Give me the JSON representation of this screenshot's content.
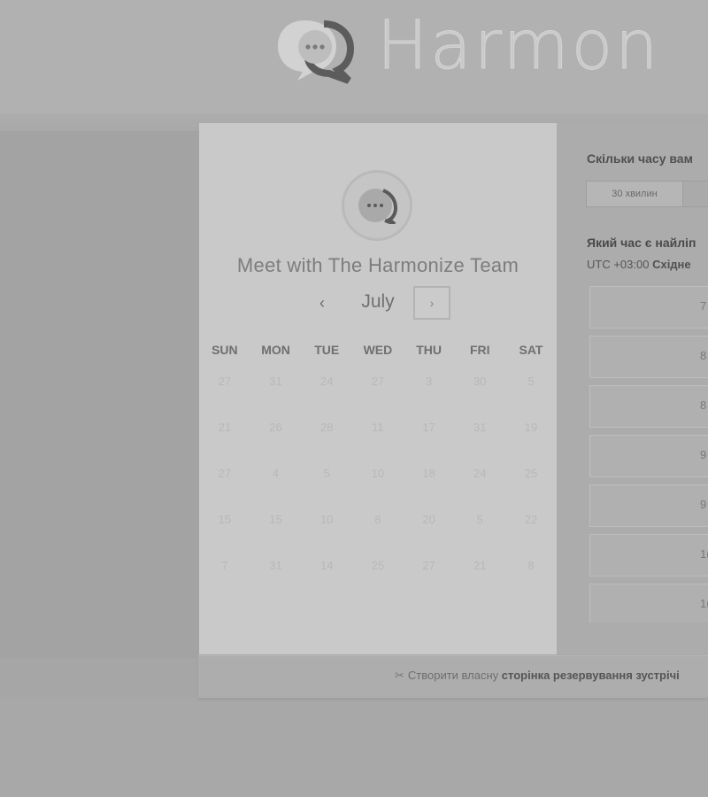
{
  "brand": {
    "name": "Harmon"
  },
  "calendar": {
    "title": "Meet with The Harmonize Team",
    "month": "July",
    "prev_label": "‹",
    "next_label": "›",
    "weekdays": [
      "SUN",
      "MON",
      "TUE",
      "WED",
      "THU",
      "FRI",
      "SAT"
    ],
    "weeks": [
      [
        "27",
        "31",
        "24",
        "27",
        "3",
        "30",
        "5"
      ],
      [
        "21",
        "26",
        "28",
        "11",
        "17",
        "31",
        "19"
      ],
      [
        "27",
        "4",
        "5",
        "10",
        "18",
        "24",
        "25"
      ],
      [
        "15",
        "15",
        "10",
        "8",
        "20",
        "5",
        "22"
      ],
      [
        "7",
        "31",
        "14",
        "25",
        "27",
        "21",
        "8"
      ]
    ]
  },
  "booking": {
    "duration_question": "Скільки часу вам",
    "duration_options": [
      "30 хвилин",
      ""
    ],
    "time_question": "Який час є найліп",
    "timezone_offset": "UTC +03:00",
    "timezone_name": "Східне",
    "slots": [
      "7",
      "8",
      "8",
      "9",
      "9",
      "1(",
      "1("
    ]
  },
  "footer": {
    "icon": "scissors-icon",
    "text_plain": "Створити власну",
    "text_bold": "сторінка резервування зустрічі"
  }
}
